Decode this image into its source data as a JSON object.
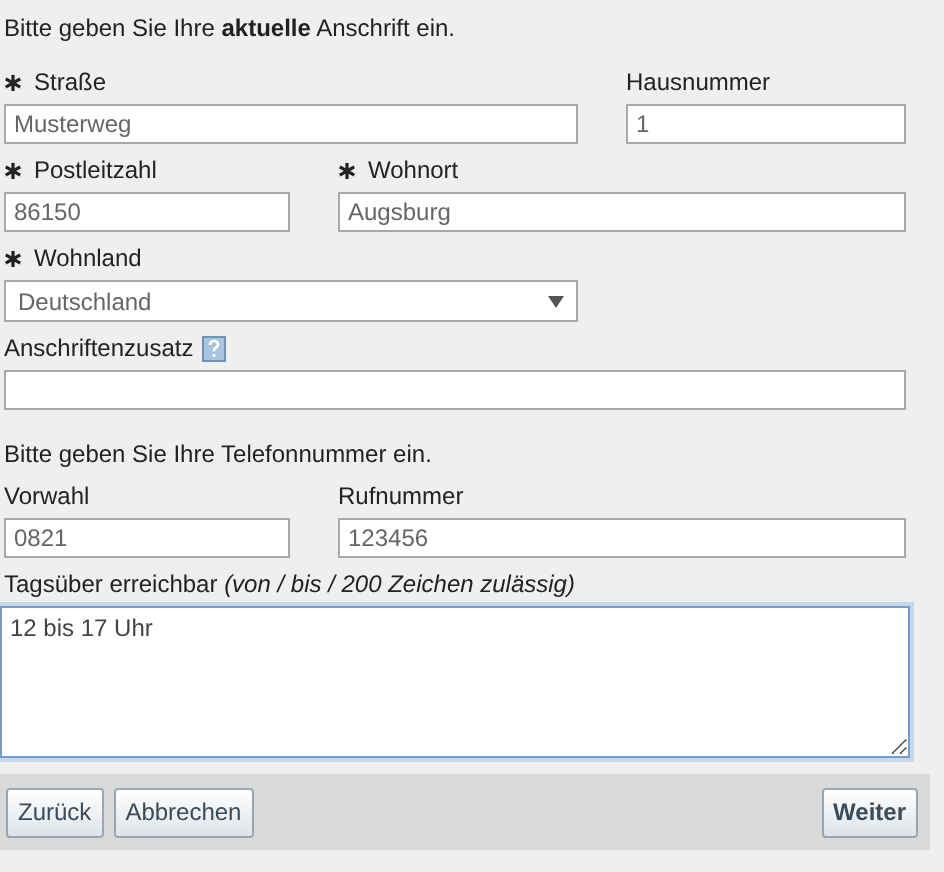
{
  "address": {
    "intro": "Bitte geben Sie Ihre **aktuelle** Anschrift ein.",
    "rows": [
      [
        {
          "label": "Straße",
          "required": true,
          "kind": "text",
          "value": "Musterweg"
        },
        {
          "label": "Hausnummer",
          "required": false,
          "kind": "text",
          "value": "1"
        }
      ],
      [
        {
          "label": "Postleitzahl",
          "required": true,
          "kind": "text",
          "value": "86150"
        },
        {
          "label": "Wohnort",
          "required": true,
          "kind": "text",
          "value": "Augsburg"
        }
      ],
      [
        {
          "label": "Wohnland",
          "required": true,
          "kind": "select",
          "value": "Deutschland"
        }
      ],
      [
        {
          "label": "Anschriftenzusatz",
          "required": false,
          "kind": "text",
          "help": true
        }
      ]
    ]
  },
  "phone": {
    "intro": "Bitte geben Sie Ihre Telefonnummer ein.",
    "rows": [
      [
        {
          "label": "Vorwahl",
          "required": false,
          "kind": "text",
          "value": "0821"
        },
        {
          "label": "Rufnummer",
          "required": false,
          "kind": "text",
          "value": "123456"
        }
      ],
      [
        {
          "label": "Tagsüber erreichbar *(von / bis / 200 Zeichen zulässig)*",
          "required": false,
          "kind": "textarea",
          "value": "12 bis 17 Uhr",
          "focused": true
        }
      ]
    ]
  },
  "buttons": [
    {
      "label": "Zurück",
      "kind": "secondary"
    },
    {
      "label": "Abbrechen",
      "kind": "secondary"
    },
    {
      "label": "Weiter",
      "kind": "primary"
    }
  ]
}
